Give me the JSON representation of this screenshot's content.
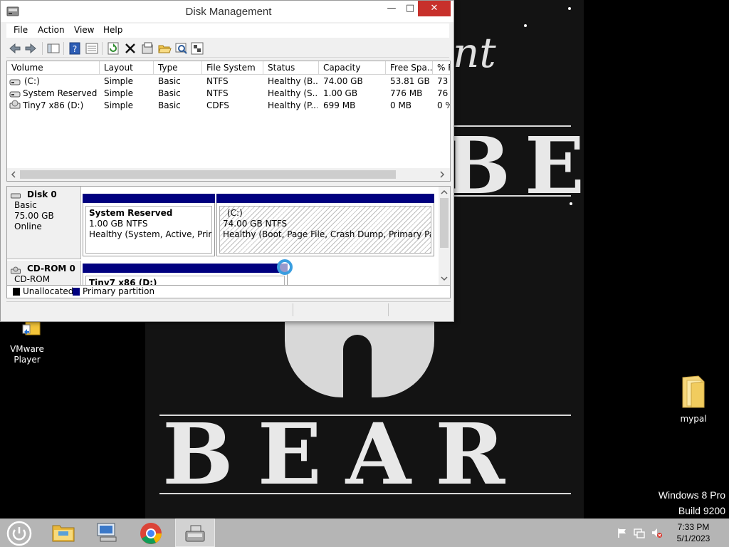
{
  "window": {
    "title": "Disk Management",
    "minimize_glyph": "—",
    "maximize_glyph": "□",
    "close_glyph": "✕"
  },
  "menu": [
    "File",
    "Action",
    "View",
    "Help"
  ],
  "toolbar_icons": [
    "back-icon",
    "forward-icon",
    "console-tree-icon",
    "help-icon",
    "properties-icon",
    "refresh-icon",
    "delete-icon",
    "settings-icon",
    "open-folder-icon",
    "search-icon",
    "rescan-icon"
  ],
  "volume_table": {
    "columns": [
      "Volume",
      "Layout",
      "Type",
      "File System",
      "Status",
      "Capacity",
      "Free Spa...",
      "% F"
    ],
    "rows": [
      [
        "(C:)",
        "Simple",
        "Basic",
        "NTFS",
        "Healthy (B...",
        "74.00 GB",
        "53.81 GB",
        "73"
      ],
      [
        "System Reserved",
        "Simple",
        "Basic",
        "NTFS",
        "Healthy (S...",
        "1.00 GB",
        "776 MB",
        "76"
      ],
      [
        "Tiny7 x86 (D:)",
        "Simple",
        "Basic",
        "CDFS",
        "Healthy (P...",
        "699 MB",
        "0 MB",
        "0 %"
      ]
    ]
  },
  "disks": {
    "disk0": {
      "name": "Disk 0",
      "type": "Basic",
      "size": "75.00 GB",
      "state": "Online",
      "partitions": [
        {
          "name": "System Reserved",
          "size": "1.00 GB NTFS",
          "status": "Healthy (System, Active, Primary"
        },
        {
          "name": "(C:)",
          "size": "74.00 GB NTFS",
          "status": "Healthy (Boot, Page File, Crash Dump, Primary Partition"
        }
      ]
    },
    "cdrom0": {
      "name": "CD-ROM 0",
      "type": "CD-ROM",
      "partitions": [
        {
          "name": "Tiny7 x86  (D:)"
        }
      ]
    }
  },
  "legend": [
    {
      "label": "Unallocated",
      "color": "#000000"
    },
    {
      "label": "Primary partition",
      "color": "#00007f"
    }
  ],
  "desktop": {
    "icons": [
      "VMware\nPlayer",
      "mypal"
    ],
    "vmware_label": "VMware Player",
    "mypal_label": "mypal",
    "watermark_line1": "Windows 8 Pro",
    "watermark_line2": "Build 9200",
    "poster_word_top": "BEAR",
    "poster_word_bottom": "BEAR",
    "poster_script": "nt"
  },
  "taskbar": {
    "apps": [
      "power-icon",
      "file-explorer-icon",
      "remote-desktop-icon",
      "chrome-icon",
      "disk-management-icon"
    ],
    "clock_time": "7:33 PM",
    "clock_date": "5/1/2023"
  }
}
